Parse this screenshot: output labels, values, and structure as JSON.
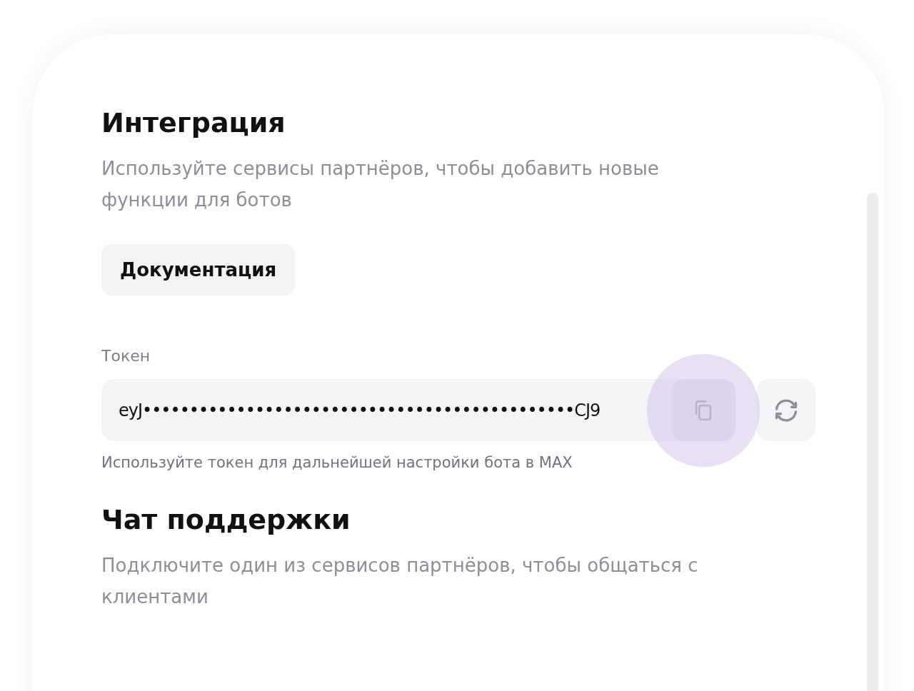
{
  "integration": {
    "title": "Интеграция",
    "description": "Используйте сервисы партнёров, чтобы добавить новые функции для ботов",
    "docs_button": "Документация"
  },
  "token": {
    "label": "Токен",
    "value": "eyJ••••••••••••••••••••••••••••••••••••••••••••••CJ9",
    "hint": "Используйте токен для дальнейшей настройки бота в MAX",
    "copy_pressed": true
  },
  "support": {
    "title": "Чат поддержки",
    "description": "Подключите один из сервисов партнёров, чтобы общаться с клиентами"
  }
}
